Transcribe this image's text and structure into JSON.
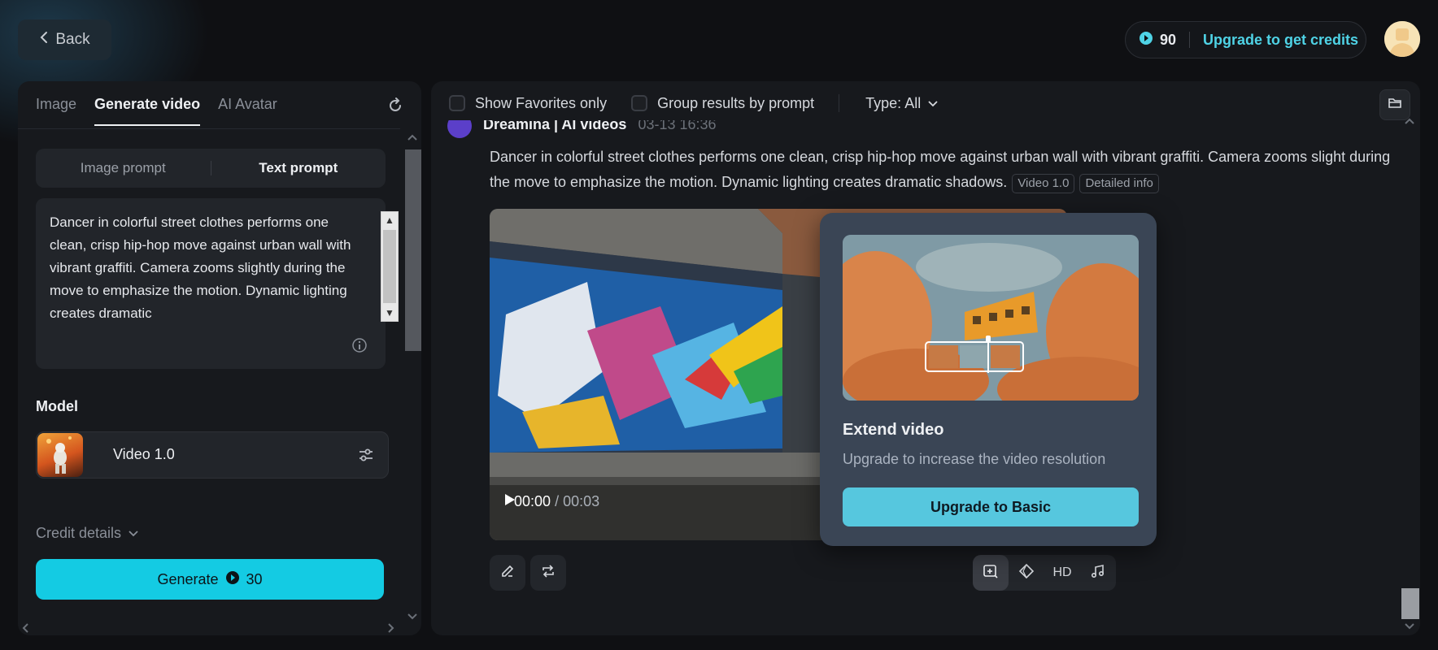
{
  "header": {
    "back_label": "Back",
    "credits": "90",
    "upgrade_label": "Upgrade to get credits"
  },
  "left": {
    "tabs": [
      "Image",
      "Generate video",
      "AI Avatar"
    ],
    "prompt_modes": [
      "Image prompt",
      "Text prompt"
    ],
    "prompt_text": "Dancer in colorful street clothes performs one clean, crisp hip-hop move against urban wall with vibrant graffiti. Camera zooms slightly during the move to emphasize the motion. Dynamic lighting creates dramatic",
    "model_label": "Model",
    "model_name": "Video 1.0",
    "credit_details_label": "Credit details",
    "generate_label": "Generate",
    "generate_cost": "30"
  },
  "right": {
    "show_favorites_label": "Show Favorites only",
    "group_results_label": "Group results by prompt",
    "type_label": "Type: All",
    "result_source": "Dreamina | AI videos",
    "result_time": "03-13 16:36",
    "result_prompt": "Dancer in colorful street clothes performs one clean, crisp hip-hop move against urban wall with vibrant graffiti. Camera zooms slight during the move to emphasize the motion. Dynamic lighting creates dramatic shadows.",
    "tag_model": "Video 1.0",
    "tag_info": "Detailed info",
    "video_current_time": "00:00",
    "video_total_time": "/ 00:03",
    "hd_label": "HD"
  },
  "popover": {
    "title": "Extend video",
    "description": "Upgrade to increase the video resolution",
    "button_label": "Upgrade to Basic"
  },
  "colors": {
    "accent": "#14cbe3",
    "upgrade_text": "#4fd3e6",
    "popover_bg": "#3a4555"
  }
}
